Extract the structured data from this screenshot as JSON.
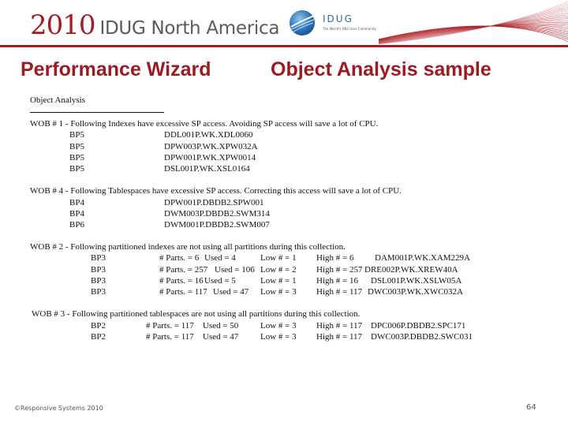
{
  "header": {
    "conference_year": "2010",
    "conference_name": "IDUG North America",
    "logo_text": "IDUG",
    "logo_tagline": "The World's DB2 User Community",
    "brand_color": "#a01e24"
  },
  "slide": {
    "title_left": "Performance Wizard",
    "title_right": "Object Analysis sample"
  },
  "content": {
    "heading": "Object Analysis",
    "wob1": {
      "text": "WOB # 1 - Following Indexes have excessive SP access.  Avoiding SP access will save a lot of CPU.",
      "rows": [
        {
          "bp": "BP5",
          "object": "DDL001P.WK.XDL0060"
        },
        {
          "bp": "BP5",
          "object": "DPW003P.WK.XPW032A"
        },
        {
          "bp": "BP5",
          "object": "DPW001P.WK.XPW0014"
        },
        {
          "bp": "BP5",
          "object": "DSL001P.WK.XSL0164"
        }
      ]
    },
    "wob4": {
      "text": "WOB # 4 - Following Tablespaces have excessive SP access. Correcting this access will save a lot of CPU.",
      "rows": [
        {
          "bp": "BP4",
          "object": "DPW001P.DBDB2.SPW001"
        },
        {
          "bp": "BP4",
          "object": "DWM003P.DBDB2.SWM314"
        },
        {
          "bp": "BP6",
          "object": "DWM001P.DBDB2.SWM007"
        }
      ]
    },
    "wob2": {
      "text": "WOB # 2 - Following partitioned indexes are not using all partitions during this collection.",
      "rows": [
        {
          "bp": "BP3",
          "parts": "# Parts. = 6",
          "used": "Used = 4",
          "low": "Low # = 1",
          "high": "High # = 6",
          "object": "DAM001P.WK.XAM229A"
        },
        {
          "bp": "BP3",
          "parts": "# Parts. = 257",
          "used": "Used = 106",
          "low": "Low # = 2",
          "high": "High # = 257",
          "object": "DRE002P.WK.XREW40A"
        },
        {
          "bp": "BP3",
          "parts": "# Parts. = 16",
          "used": "Used = 5",
          "low": "Low # = 1",
          "high": "High # = 16",
          "object": "DSL001P.WK.XSLW05A"
        },
        {
          "bp": "BP3",
          "parts": "# Parts. = 117",
          "used": "Used = 47",
          "low": "Low # = 3",
          "high": "High # = 117",
          "object": "DWC003P.WK.XWC032A"
        }
      ]
    },
    "wob3": {
      "text": "WOB # 3 - Following partitioned tablespaces are not using all partitions during this collection.",
      "rows": [
        {
          "bp": "BP2",
          "parts": "# Parts. = 117",
          "used": "Used = 50",
          "low": "Low # = 3",
          "high": "High # = 117",
          "object": "DPC006P.DBDB2.SPC171"
        },
        {
          "bp": "BP2",
          "parts": "# Parts. = 117",
          "used": "Used = 47",
          "low": "Low # = 3",
          "high": "High # = 117",
          "object": "DWC003P.DBDB2.SWC031"
        }
      ]
    }
  },
  "footer": {
    "copyright": "©Responsive Systems 2010",
    "page_number": "64"
  }
}
